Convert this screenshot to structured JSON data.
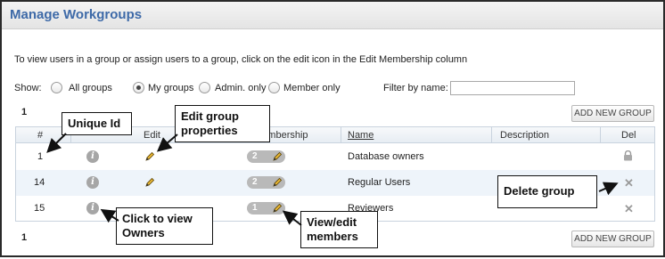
{
  "header": {
    "title": "Manage Workgroups"
  },
  "instructions": "To view users in a group or assign users to a group, click on the edit icon in the Edit Membership column",
  "filters": {
    "show_label": "Show:",
    "options": [
      {
        "label": "All groups",
        "checked": false
      },
      {
        "label": "My groups",
        "checked": true
      },
      {
        "label": "Admin. only",
        "checked": false
      },
      {
        "label": "Member only",
        "checked": false
      }
    ],
    "filter_label": "Filter by name:",
    "filter_value": ""
  },
  "pager": {
    "top_count": "1",
    "bottom_count": "1"
  },
  "add_button_label": "ADD NEW GROUP",
  "table": {
    "columns": {
      "id": "#",
      "edit": "Edit",
      "membership": "Edit Membership",
      "name": "Name",
      "description": "Description",
      "del": "Del"
    },
    "rows": [
      {
        "id": "1",
        "members": "2",
        "name": "Database owners",
        "description": "",
        "del": "lock"
      },
      {
        "id": "14",
        "members": "2",
        "name": "Regular Users",
        "description": "",
        "del": "delete"
      },
      {
        "id": "15",
        "members": "1",
        "name": "Reviewers",
        "description": "",
        "del": "delete"
      }
    ]
  },
  "callouts": {
    "unique_id": "Unique Id",
    "edit_group": "Edit group properties",
    "delete_group": "Delete group",
    "view_owners": "Click to view Owners",
    "view_members": "View/edit members"
  },
  "colors": {
    "title": "#3e6aa8",
    "alt_row": "#eef4fa",
    "border": "#c9d3de"
  }
}
